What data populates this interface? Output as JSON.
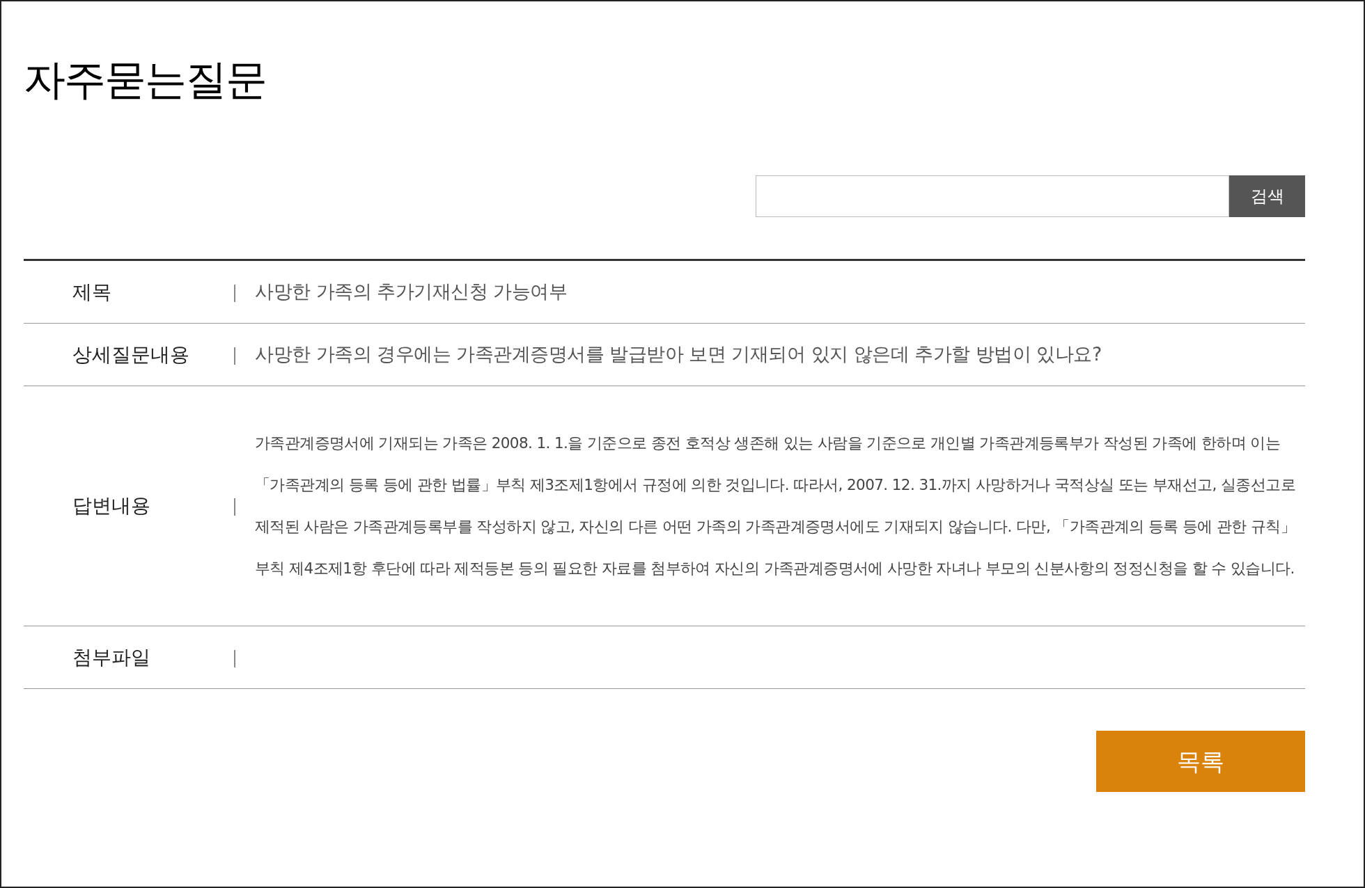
{
  "page_title": "자주묻는질문",
  "search": {
    "button": "검색"
  },
  "rows": [
    {
      "kind": "short",
      "label": "제목",
      "separator": "|",
      "value": "사망한 가족의 추가기재신청 가능여부"
    },
    {
      "kind": "short",
      "label": "상세질문내용",
      "separator": "|",
      "value": "사망한 가족의 경우에는 가족관계증명서를 발급받아 보면 기재되어 있지 않은데 추가할 방법이 있나요?"
    },
    {
      "kind": "long",
      "label": "답변내용",
      "separator": "|",
      "value": "가족관계증명서에 기재되는 가족은 2008. 1. 1.을 기준으로 종전 호적상 생존해 있는 사람을 기준으로 개인별 가족관계등록부가 작성된 가족에 한하며 이는「가족관계의 등록 등에 관한 법률」부칙 제3조제1항에서 규정에 의한 것입니다. 따라서, 2007. 12. 31.까지 사망하거나 국적상실 또는 부재선고, 실종선고로 제적된 사람은 가족관계등록부를 작성하지 않고, 자신의 다른 어떤 가족의 가족관계증명서에도 기재되지 않습니다. 다만, 「가족관계의 등록 등에 관한 규칙」 부칙 제4조제1항 후단에 따라 제적등본 등의 필요한 자료를 첨부하여 자신의 가족관계증명서에 사망한 자녀나 부모의 신분사항의 정정신청을 할 수 있습니다."
    },
    {
      "kind": "short",
      "label": "첨부파일",
      "separator": "|"
    }
  ],
  "list_button": "목록"
}
